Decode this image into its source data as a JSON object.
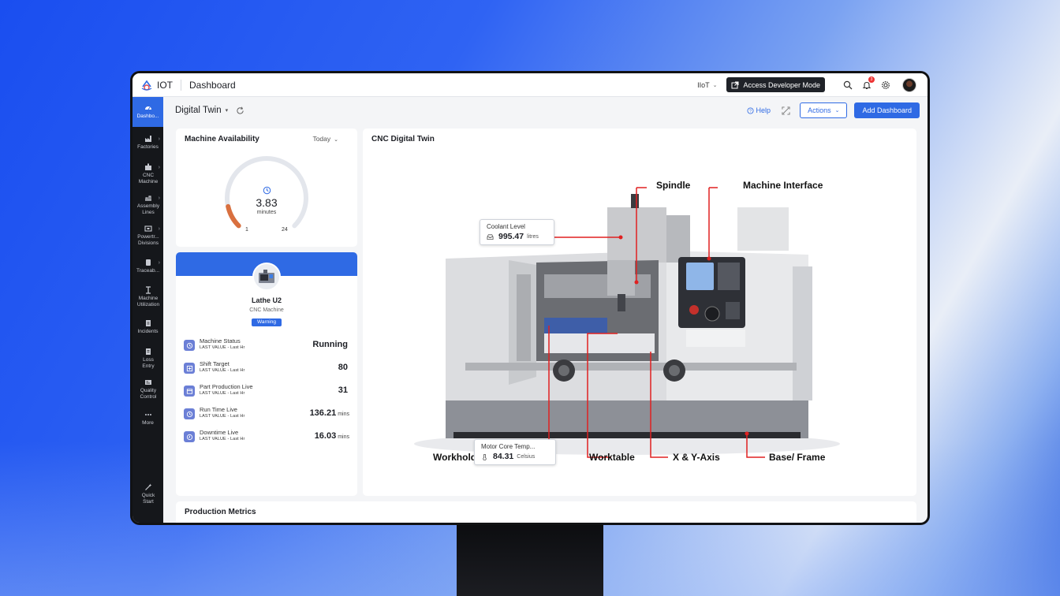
{
  "app": {
    "name": "IOT",
    "section": "Dashboard"
  },
  "topbar": {
    "org": "IIoT",
    "dev_mode": "Access Developer Mode",
    "notification_count": "3"
  },
  "sidebar": {
    "items": [
      {
        "label": "Dashbo...",
        "icon": "dashboard-icon",
        "active": true
      },
      {
        "label": "Factories",
        "icon": "factory-icon"
      },
      {
        "label": "CNC Machine",
        "icon": "cnc-icon"
      },
      {
        "label": "Assembly Lines",
        "icon": "assembly-icon"
      },
      {
        "label": "Powertr... Divisions",
        "icon": "division-icon"
      },
      {
        "label": "Traceab...",
        "icon": "trace-icon"
      },
      {
        "label": "Machine Utilization",
        "icon": "utilization-icon"
      },
      {
        "label": "Incidents",
        "icon": "incident-icon"
      },
      {
        "label": "Loss Entry",
        "icon": "loss-icon"
      },
      {
        "label": "Quality Control",
        "icon": "quality-icon"
      },
      {
        "label": "More",
        "icon": "more-icon"
      },
      {
        "label": "Quick Start",
        "icon": "wand-icon"
      }
    ]
  },
  "header": {
    "title": "Digital Twin",
    "help": "Help",
    "actions": "Actions",
    "add_dashboard": "Add Dashboard"
  },
  "availability": {
    "title": "Machine Availability",
    "range": "Today",
    "value": "3.83",
    "unit": "minutes",
    "min": "1",
    "max": "24",
    "fill_fraction": 0.12,
    "accent": "#d9703f"
  },
  "machine": {
    "name": "Lathe U2",
    "type": "CNC Machine",
    "status": "Warning",
    "metrics": [
      {
        "name": "Machine Status",
        "sub": "LAST VALUE - Last Hr",
        "value": "Running",
        "unit": ""
      },
      {
        "name": "Shift Target",
        "sub": "LAST VALUE - Last Hr",
        "value": "80",
        "unit": ""
      },
      {
        "name": "Part Production Live",
        "sub": "LAST VALUE - Last Hr",
        "value": "31",
        "unit": ""
      },
      {
        "name": "Run Time Live",
        "sub": "LAST VALUE - Last Hr",
        "value": "136.21",
        "unit": "mins"
      },
      {
        "name": "Downtime Live",
        "sub": "LAST VALUE - Last Hr",
        "value": "16.03",
        "unit": "mins"
      }
    ]
  },
  "twin": {
    "title": "CNC Digital Twin",
    "labels": {
      "spindle": "Spindle",
      "interface": "Machine Interface",
      "workholding": "Workholding",
      "worktable": "Worktable",
      "axis": "X & Y-Axis",
      "base": "Base/ Frame"
    },
    "coolant": {
      "title": "Coolant Level",
      "value": "995.47",
      "unit": "litres"
    },
    "motor": {
      "title": "Motor Core Temp...",
      "value": "84.31",
      "unit": "Celsius"
    }
  },
  "production": {
    "title": "Production Metrics"
  },
  "colors": {
    "accent": "#2f6ae4",
    "sidebar": "#15171b",
    "callout": "#e02020"
  }
}
